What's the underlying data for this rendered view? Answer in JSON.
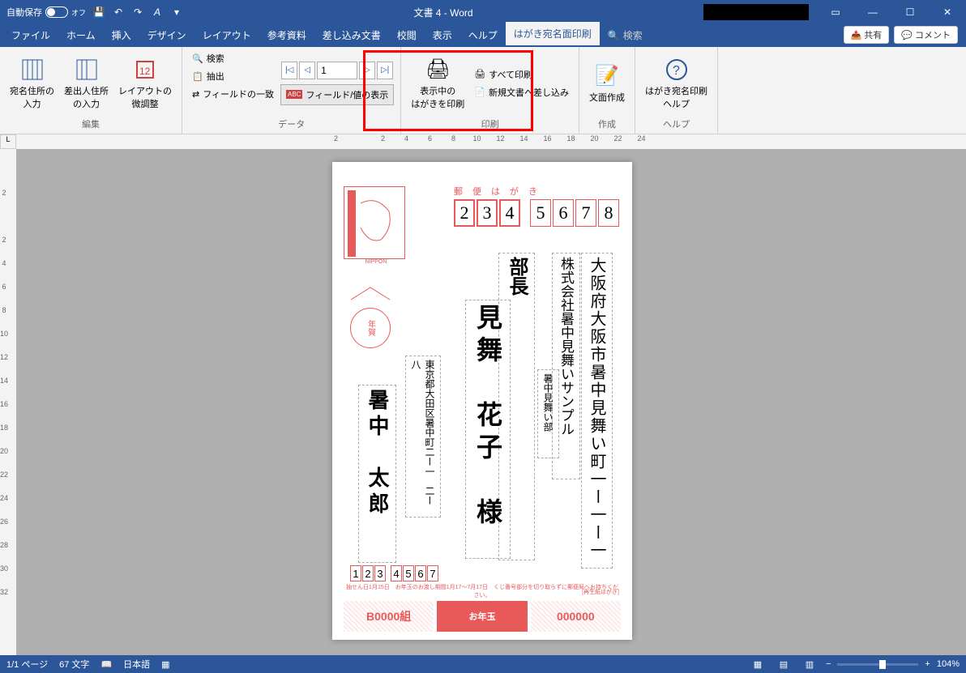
{
  "titlebar": {
    "autosave_label": "自動保存",
    "autosave_state": "オフ",
    "doc_title": "文書 4  -  Word"
  },
  "tabs": {
    "file": "ファイル",
    "home": "ホーム",
    "insert": "挿入",
    "design": "デザイン",
    "layout": "レイアウト",
    "references": "参考資料",
    "mailings": "差し込み文書",
    "review": "校閲",
    "view": "表示",
    "help": "ヘルプ",
    "hagaki": "はがき宛名面印刷",
    "search": "検索",
    "share": "共有",
    "comment": "コメント"
  },
  "ribbon": {
    "edit": {
      "recipient_addr": "宛名住所の\n入力",
      "sender_addr": "差出人住所\nの入力",
      "layout_adjust": "レイアウトの\n微調整",
      "group_label": "編集"
    },
    "data": {
      "search": "検索",
      "extract": "抽出",
      "field_match": "フィールドの一致",
      "record_num": "1",
      "field_display": "フィールド/値の表示",
      "group_label": "データ"
    },
    "print": {
      "print_current": "表示中の\nはがきを印刷",
      "print_all": "すべて印刷",
      "merge_new": "新規文書へ差し込み",
      "group_label": "印刷"
    },
    "create": {
      "create_text": "文面作成",
      "group_label": "作成"
    },
    "help": {
      "help_btn": "はがき宛名印刷\nヘルプ",
      "group_label": "ヘルプ"
    }
  },
  "hagaki": {
    "header": "郵便はがき",
    "postal_code": [
      "2",
      "3",
      "4",
      "5",
      "6",
      "7",
      "8"
    ],
    "nippon": "NIPPON",
    "nenga": "年賀",
    "recipient_address": "大阪府大阪市暑中見舞い町一ー一ー一",
    "company": "株式会社暑中見舞いサンプル",
    "department": "暑中見舞い部",
    "title": "部長",
    "recipient_name": "見舞　花子　様",
    "sender_address": "東京都大田区暑中町二ー一　二ー八",
    "sender_name": "暑中　太郎",
    "sender_postal": [
      "1",
      "2",
      "3",
      "4",
      "5",
      "6",
      "7"
    ],
    "recycle": "[再生紙はがき]",
    "lottery": "抽せん日1月15日　お年玉のお渡し期間1月17〜7月17日　くじ番号部分を切り取らずに郵便局へお持ちください。",
    "bottom_left": "B0000組",
    "bottom_center": "お年玉",
    "bottom_right": "000000"
  },
  "ruler_h": [
    "2",
    "",
    "2",
    "4",
    "6",
    "8",
    "10",
    "12",
    "14",
    "16",
    "18",
    "20",
    "22",
    "24"
  ],
  "ruler_v": [
    "",
    "2",
    "",
    "2",
    "4",
    "6",
    "8",
    "10",
    "12",
    "14",
    "16",
    "18",
    "20",
    "22",
    "24",
    "26",
    "28",
    "30",
    "32"
  ],
  "statusbar": {
    "page": "1/1 ページ",
    "words": "67 文字",
    "lang": "日本語",
    "zoom": "104%"
  }
}
